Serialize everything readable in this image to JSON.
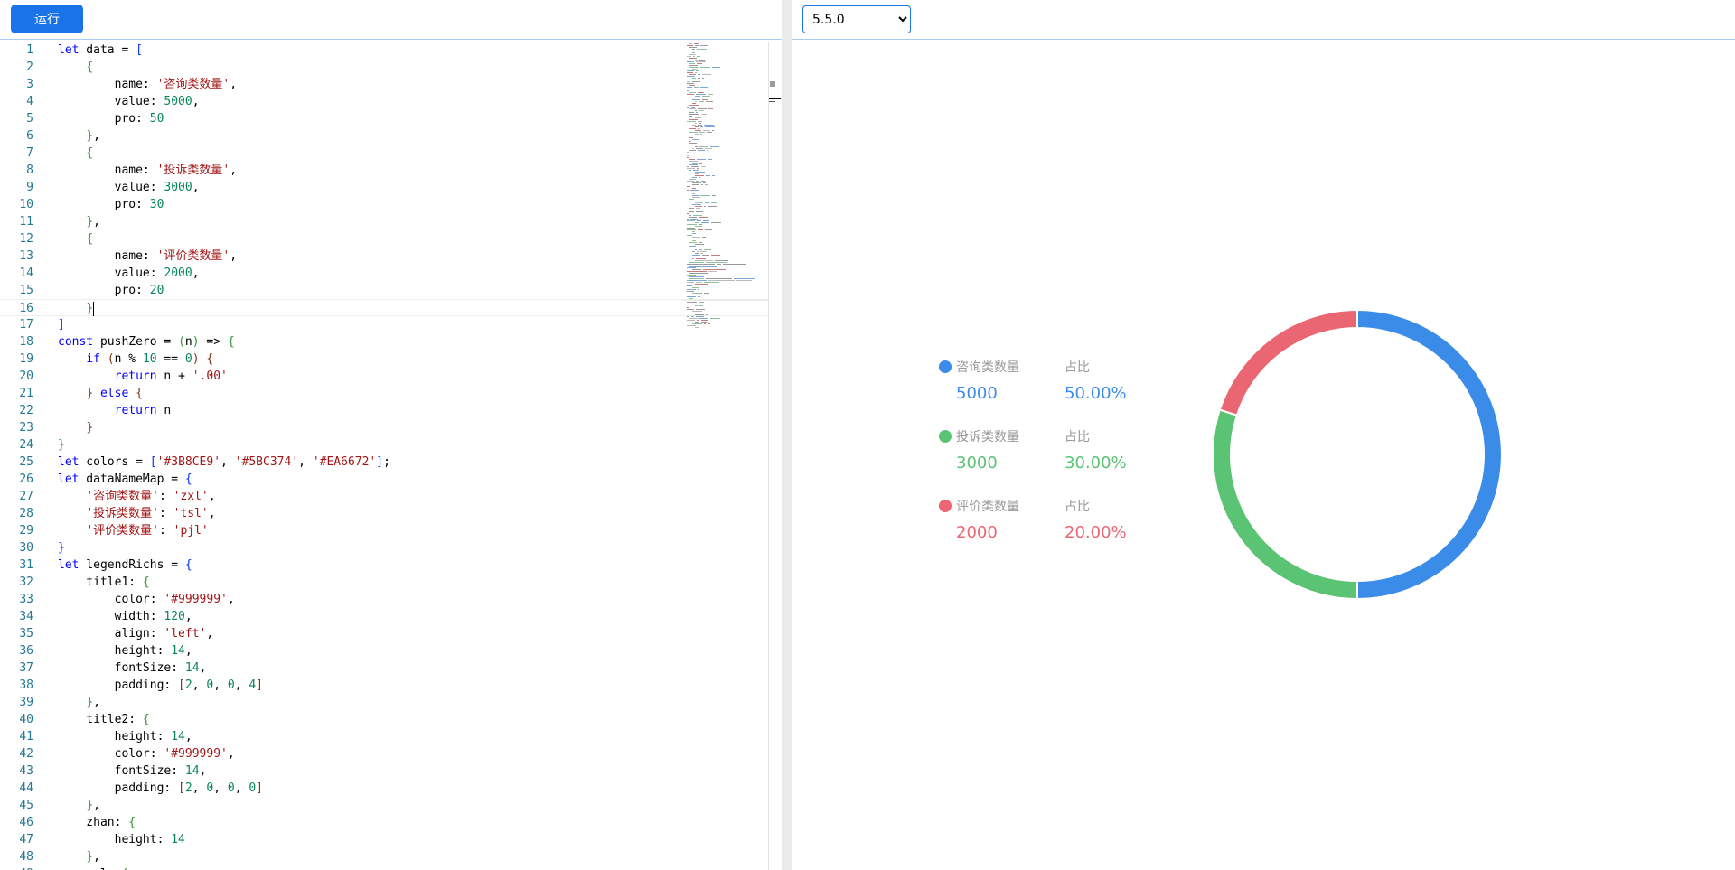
{
  "toolbar": {
    "run_label": "运行"
  },
  "version_select": {
    "selected": "5.5.0",
    "options": [
      "5.5.0"
    ]
  },
  "editor": {
    "lines": [
      [
        [
          "t-kw",
          "let"
        ],
        [
          "t-plain",
          " data = "
        ],
        [
          "t-br",
          "["
        ]
      ],
      [
        [
          "t-plain",
          "    "
        ],
        [
          "t-br2",
          "{"
        ]
      ],
      [
        [
          "t-plain",
          "        name: "
        ],
        [
          "t-str",
          "'咨询类数量'"
        ],
        [
          "t-plain",
          ","
        ]
      ],
      [
        [
          "t-plain",
          "        value: "
        ],
        [
          "t-num",
          "5000"
        ],
        [
          "t-plain",
          ","
        ]
      ],
      [
        [
          "t-plain",
          "        pro: "
        ],
        [
          "t-num",
          "50"
        ]
      ],
      [
        [
          "t-plain",
          "    "
        ],
        [
          "t-br2",
          "}"
        ],
        [
          "t-plain",
          ","
        ]
      ],
      [
        [
          "t-plain",
          "    "
        ],
        [
          "t-br2",
          "{"
        ]
      ],
      [
        [
          "t-plain",
          "        name: "
        ],
        [
          "t-str",
          "'投诉类数量'"
        ],
        [
          "t-plain",
          ","
        ]
      ],
      [
        [
          "t-plain",
          "        value: "
        ],
        [
          "t-num",
          "3000"
        ],
        [
          "t-plain",
          ","
        ]
      ],
      [
        [
          "t-plain",
          "        pro: "
        ],
        [
          "t-num",
          "30"
        ]
      ],
      [
        [
          "t-plain",
          "    "
        ],
        [
          "t-br2",
          "}"
        ],
        [
          "t-plain",
          ","
        ]
      ],
      [
        [
          "t-plain",
          "    "
        ],
        [
          "t-br2",
          "{"
        ]
      ],
      [
        [
          "t-plain",
          "        name: "
        ],
        [
          "t-str",
          "'评价类数量'"
        ],
        [
          "t-plain",
          ","
        ]
      ],
      [
        [
          "t-plain",
          "        value: "
        ],
        [
          "t-num",
          "2000"
        ],
        [
          "t-plain",
          ","
        ]
      ],
      [
        [
          "t-plain",
          "        pro: "
        ],
        [
          "t-num",
          "20"
        ]
      ],
      [
        [
          "t-plain",
          "    "
        ],
        [
          "t-br2",
          "}"
        ]
      ],
      [
        [
          "t-br",
          "]"
        ]
      ],
      [
        [
          "t-kw",
          "const"
        ],
        [
          "t-plain",
          " pushZero = "
        ],
        [
          "t-br2",
          "("
        ],
        [
          "t-plain",
          "n"
        ],
        [
          "t-br2",
          ")"
        ],
        [
          "t-plain",
          " => "
        ],
        [
          "t-br2",
          "{"
        ]
      ],
      [
        [
          "t-plain",
          "    "
        ],
        [
          "t-kw",
          "if"
        ],
        [
          "t-plain",
          " "
        ],
        [
          "t-br3",
          "("
        ],
        [
          "t-plain",
          "n % "
        ],
        [
          "t-num",
          "10"
        ],
        [
          "t-plain",
          " == "
        ],
        [
          "t-num",
          "0"
        ],
        [
          "t-br3",
          ")"
        ],
        [
          "t-plain",
          " "
        ],
        [
          "t-br3",
          "{"
        ]
      ],
      [
        [
          "t-plain",
          "        "
        ],
        [
          "t-kw",
          "return"
        ],
        [
          "t-plain",
          " n + "
        ],
        [
          "t-str",
          "'.00'"
        ]
      ],
      [
        [
          "t-plain",
          "    "
        ],
        [
          "t-br3",
          "}"
        ],
        [
          "t-plain",
          " "
        ],
        [
          "t-kw",
          "else"
        ],
        [
          "t-plain",
          " "
        ],
        [
          "t-br3",
          "{"
        ]
      ],
      [
        [
          "t-plain",
          "        "
        ],
        [
          "t-kw",
          "return"
        ],
        [
          "t-plain",
          " n"
        ]
      ],
      [
        [
          "t-plain",
          "    "
        ],
        [
          "t-br3",
          "}"
        ]
      ],
      [
        [
          "t-br2",
          "}"
        ]
      ],
      [
        [
          "t-kw",
          "let"
        ],
        [
          "t-plain",
          " colors = "
        ],
        [
          "t-br",
          "["
        ],
        [
          "t-str",
          "'#3B8CE9'"
        ],
        [
          "t-plain",
          ", "
        ],
        [
          "t-str",
          "'#5BC374'"
        ],
        [
          "t-plain",
          ", "
        ],
        [
          "t-str",
          "'#EA6672'"
        ],
        [
          "t-br",
          "]"
        ],
        [
          "t-plain",
          ";"
        ]
      ],
      [
        [
          "t-kw",
          "let"
        ],
        [
          "t-plain",
          " dataNameMap = "
        ],
        [
          "t-br",
          "{"
        ]
      ],
      [
        [
          "t-plain",
          "    "
        ],
        [
          "t-str",
          "'咨询类数量'"
        ],
        [
          "t-plain",
          ": "
        ],
        [
          "t-str",
          "'zxl'"
        ],
        [
          "t-plain",
          ","
        ]
      ],
      [
        [
          "t-plain",
          "    "
        ],
        [
          "t-str",
          "'投诉类数量'"
        ],
        [
          "t-plain",
          ": "
        ],
        [
          "t-str",
          "'tsl'"
        ],
        [
          "t-plain",
          ","
        ]
      ],
      [
        [
          "t-plain",
          "    "
        ],
        [
          "t-str",
          "'评价类数量'"
        ],
        [
          "t-plain",
          ": "
        ],
        [
          "t-str",
          "'pjl'"
        ]
      ],
      [
        [
          "t-br",
          "}"
        ]
      ],
      [
        [
          "t-kw",
          "let"
        ],
        [
          "t-plain",
          " legendRichs = "
        ],
        [
          "t-br",
          "{"
        ]
      ],
      [
        [
          "t-plain",
          "    title1: "
        ],
        [
          "t-br2",
          "{"
        ]
      ],
      [
        [
          "t-plain",
          "        color: "
        ],
        [
          "t-str",
          "'#999999'"
        ],
        [
          "t-plain",
          ","
        ]
      ],
      [
        [
          "t-plain",
          "        width: "
        ],
        [
          "t-num",
          "120"
        ],
        [
          "t-plain",
          ","
        ]
      ],
      [
        [
          "t-plain",
          "        align: "
        ],
        [
          "t-str",
          "'left'"
        ],
        [
          "t-plain",
          ","
        ]
      ],
      [
        [
          "t-plain",
          "        height: "
        ],
        [
          "t-num",
          "14"
        ],
        [
          "t-plain",
          ","
        ]
      ],
      [
        [
          "t-plain",
          "        fontSize: "
        ],
        [
          "t-num",
          "14"
        ],
        [
          "t-plain",
          ","
        ]
      ],
      [
        [
          "t-plain",
          "        padding: "
        ],
        [
          "t-br3",
          "["
        ],
        [
          "t-num",
          "2"
        ],
        [
          "t-plain",
          ", "
        ],
        [
          "t-num",
          "0"
        ],
        [
          "t-plain",
          ", "
        ],
        [
          "t-num",
          "0"
        ],
        [
          "t-plain",
          ", "
        ],
        [
          "t-num",
          "4"
        ],
        [
          "t-br3",
          "]"
        ]
      ],
      [
        [
          "t-plain",
          "    "
        ],
        [
          "t-br2",
          "}"
        ],
        [
          "t-plain",
          ","
        ]
      ],
      [
        [
          "t-plain",
          "    title2: "
        ],
        [
          "t-br2",
          "{"
        ]
      ],
      [
        [
          "t-plain",
          "        height: "
        ],
        [
          "t-num",
          "14"
        ],
        [
          "t-plain",
          ","
        ]
      ],
      [
        [
          "t-plain",
          "        color: "
        ],
        [
          "t-str",
          "'#999999'"
        ],
        [
          "t-plain",
          ","
        ]
      ],
      [
        [
          "t-plain",
          "        fontSize: "
        ],
        [
          "t-num",
          "14"
        ],
        [
          "t-plain",
          ","
        ]
      ],
      [
        [
          "t-plain",
          "        padding: "
        ],
        [
          "t-br3",
          "["
        ],
        [
          "t-num",
          "2"
        ],
        [
          "t-plain",
          ", "
        ],
        [
          "t-num",
          "0"
        ],
        [
          "t-plain",
          ", "
        ],
        [
          "t-num",
          "0"
        ],
        [
          "t-plain",
          ", "
        ],
        [
          "t-num",
          "0"
        ],
        [
          "t-br3",
          "]"
        ]
      ],
      [
        [
          "t-plain",
          "    "
        ],
        [
          "t-br2",
          "}"
        ],
        [
          "t-plain",
          ","
        ]
      ],
      [
        [
          "t-plain",
          "    zhan: "
        ],
        [
          "t-br2",
          "{"
        ]
      ],
      [
        [
          "t-plain",
          "        height: "
        ],
        [
          "t-num",
          "14"
        ]
      ],
      [
        [
          "t-plain",
          "    "
        ],
        [
          "t-br2",
          "}"
        ],
        [
          "t-plain",
          ","
        ]
      ],
      [
        [
          "t-plain",
          "    zxl: "
        ],
        [
          "t-br2",
          "{"
        ]
      ]
    ]
  },
  "chart_data": {
    "type": "pie",
    "subtype": "donut",
    "categories": [
      "咨询类数量",
      "投诉类数量",
      "评价类数量"
    ],
    "values": [
      5000,
      3000,
      2000
    ],
    "percent_labels": [
      "50.00%",
      "30.00%",
      "20.00%"
    ],
    "ratio_label": "占比",
    "colors": [
      "#3B8CE9",
      "#5BC374",
      "#EA6672"
    ],
    "legend_position": "left"
  }
}
